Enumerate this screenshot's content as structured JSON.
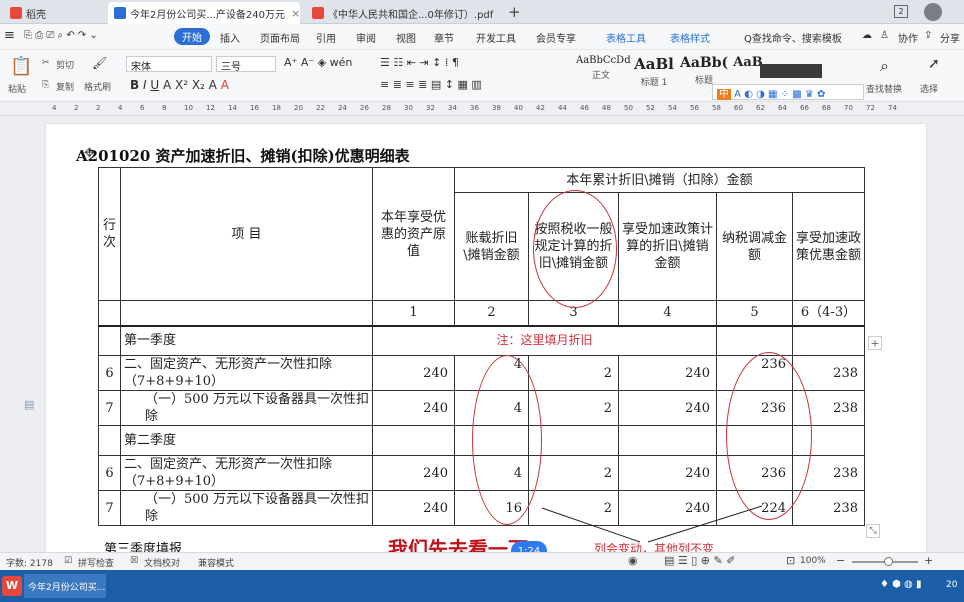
{
  "tabs": [
    {
      "label": "稻壳",
      "icon_color": "#e8483b"
    },
    {
      "label": "今年2月份公司买...产设备240万元",
      "icon_color": "#2b6fd6"
    },
    {
      "label": "《中华人民共和国企...0年修订）.pdf",
      "icon_color": "#e8483b"
    }
  ],
  "tab_add": "+",
  "window_badge": "2",
  "menu": {
    "start": "开始",
    "items": [
      "插入",
      "页面布局",
      "引用",
      "审阅",
      "视图",
      "章节",
      "开发工具",
      "会员专享"
    ],
    "context_items": [
      "表格工具",
      "表格样式"
    ],
    "search": "Q查找命令、搜索模板",
    "collab": "协作",
    "share": "分享"
  },
  "ribbon": {
    "paste": "粘贴",
    "cut": "剪切",
    "copy": "复制",
    "format_painter": "格式刷",
    "font_name": "宋体",
    "font_size": "三号",
    "styles": [
      {
        "preview": "AaBbCcDd",
        "label": "正文"
      },
      {
        "preview": "AaBl",
        "label": "标题 1"
      },
      {
        "preview": "AaBb(",
        "label": "标题"
      },
      {
        "preview": "AaB",
        "label": ""
      }
    ],
    "find_replace": "查找替换",
    "select": "选择"
  },
  "ruler_numbers": [
    "4",
    "2",
    "2",
    "4",
    "6",
    "8",
    "10",
    "12",
    "14",
    "16",
    "18",
    "20",
    "22",
    "24",
    "26",
    "28",
    "30",
    "32",
    "34",
    "36",
    "38",
    "40",
    "42",
    "44",
    "46",
    "48",
    "50",
    "52",
    "54",
    "56",
    "58",
    "60",
    "62",
    "64",
    "66",
    "68",
    "70",
    "72",
    "74"
  ],
  "document": {
    "title": "A201020  资产加速折旧、摊销(扣除)优惠明细表",
    "header": {
      "row_no": "行次",
      "item": "项          目",
      "original_value": "本年享受优惠的资产原值",
      "group": "本年累计折旧\\摊销（扣除）金额",
      "cols": [
        "账载折旧\\摊销金额",
        "按照税收一般规定计算的折旧\\摊销金额",
        "享受加速政策计算的折旧\\摊销金额",
        "纳税调减金额",
        "享受加速政策优惠金额"
      ],
      "col_numbers": [
        "1",
        "2",
        "3",
        "4",
        "5",
        "6（4-3）"
      ]
    },
    "note": "注：这里填月折旧",
    "sections": [
      {
        "label": "第一季度",
        "rows": [
          {
            "no": "6",
            "item": "二、固定资产、无形资产一次性扣除（7+8+9+10）",
            "v": [
              "240",
              "4",
              "2",
              "240",
              "236",
              "238"
            ]
          },
          {
            "no": "7",
            "item": "（一）500 万元以下设备器具一次性扣除",
            "v": [
              "240",
              "4",
              "2",
              "240",
              "236",
              "238"
            ]
          }
        ]
      },
      {
        "label": "第二季度",
        "rows": [
          {
            "no": "6",
            "item": "二、固定资产、无形资产一次性扣除（7+8+9+10）",
            "v": [
              "240",
              "4",
              "2",
              "240",
              "236",
              "238"
            ]
          },
          {
            "no": "7",
            "item": "（一）500 万元以下设备器具一次性扣除",
            "v": [
              "240",
              "16",
              "2",
              "240",
              "224",
              "238"
            ]
          }
        ]
      }
    ],
    "below_title": "第三季度填报",
    "red_tail": "列会变动，其他列不变"
  },
  "overlay": {
    "caption": "我们先去看一下",
    "timer": "1:24"
  },
  "status": {
    "word_count": "字数: 2178",
    "spell_check": "拼写检查",
    "doc_proof": "文档校对",
    "compat_mode": "兼容模式",
    "zoom": "100%"
  },
  "taskbar": {
    "item": "今年2月份公司买...",
    "clock": "20"
  },
  "colors": {
    "accent": "#2b6fd6",
    "annotation_red": "#c9303a",
    "caption_red": "#c1121c",
    "taskbar": "#1c5fa8"
  }
}
